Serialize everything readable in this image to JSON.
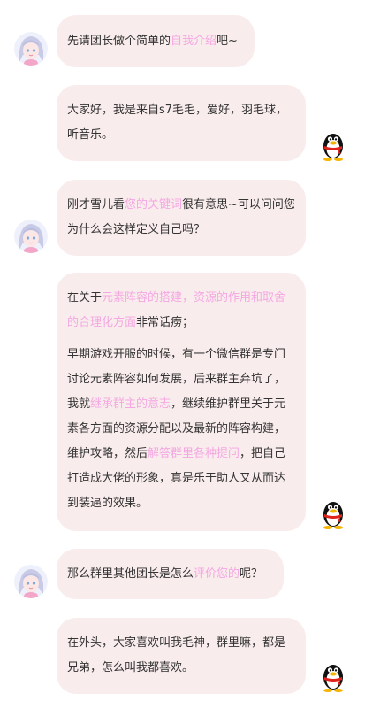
{
  "messages": [
    {
      "side": "left",
      "parts": [
        {
          "t": "先请团长做个简单的"
        },
        {
          "t": "自我介绍",
          "hl": true
        },
        {
          "t": "吧~"
        }
      ]
    },
    {
      "side": "right",
      "parts": [
        {
          "t": "大家好，我是来自s7毛毛，爱好，羽毛球，听音乐。"
        }
      ]
    },
    {
      "side": "left",
      "parts": [
        {
          "t": "刚才雪儿看"
        },
        {
          "t": "您的关键词",
          "hl": true
        },
        {
          "t": "很有意思~可以问问您为什么会这样定义自己吗？"
        }
      ]
    },
    {
      "side": "right",
      "p1": [
        {
          "t": "在关于"
        },
        {
          "t": "元素阵容的搭建，资源的作用和取舍的合理化方面",
          "hl": true
        },
        {
          "t": "非常话痨；"
        }
      ],
      "p2": [
        {
          "t": "早期游戏开服的时候，有一个微信群是专门讨论元素阵容如何发展，后来群主弃坑了，我就"
        },
        {
          "t": "继承群主的意志",
          "hl": true
        },
        {
          "t": "，继续维护群里关于元素各方面的资源分配以及最新的阵容构建，维护攻略，然后"
        },
        {
          "t": "解答群里各种提问",
          "hl": true
        },
        {
          "t": "，把自己打造成大佬的形象，真是乐于助人又从而达到装逼的效果。"
        }
      ]
    },
    {
      "side": "left",
      "parts": [
        {
          "t": "那么群里其他团长是怎么"
        },
        {
          "t": "评价您的",
          "hl": true
        },
        {
          "t": "呢？"
        }
      ]
    },
    {
      "side": "right",
      "parts": [
        {
          "t": "在外头，大家喜欢叫我毛神，群里嘛，都是兄弟，怎么叫我都喜欢。"
        }
      ]
    }
  ],
  "colors": {
    "bubble": "#f9ecec",
    "highlight": "#f4a7e2",
    "text": "#333333"
  },
  "icons": {
    "host": "anime-girl-avatar",
    "guest": "qq-penguin-icon"
  }
}
